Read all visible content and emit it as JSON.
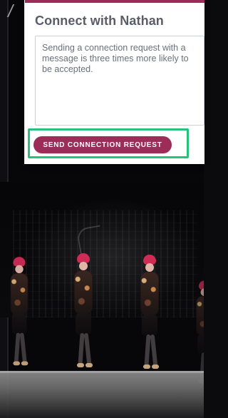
{
  "modal": {
    "title": "Connect with Nathan",
    "message": {
      "value": "Sending a connection request with a\nmessage is three times more likely to\nbe accepted."
    },
    "cta": {
      "label": "SEND CONNECTION REQUEST"
    },
    "colors": {
      "accent": "#9b2d58",
      "highlight": "#26c27a"
    }
  }
}
